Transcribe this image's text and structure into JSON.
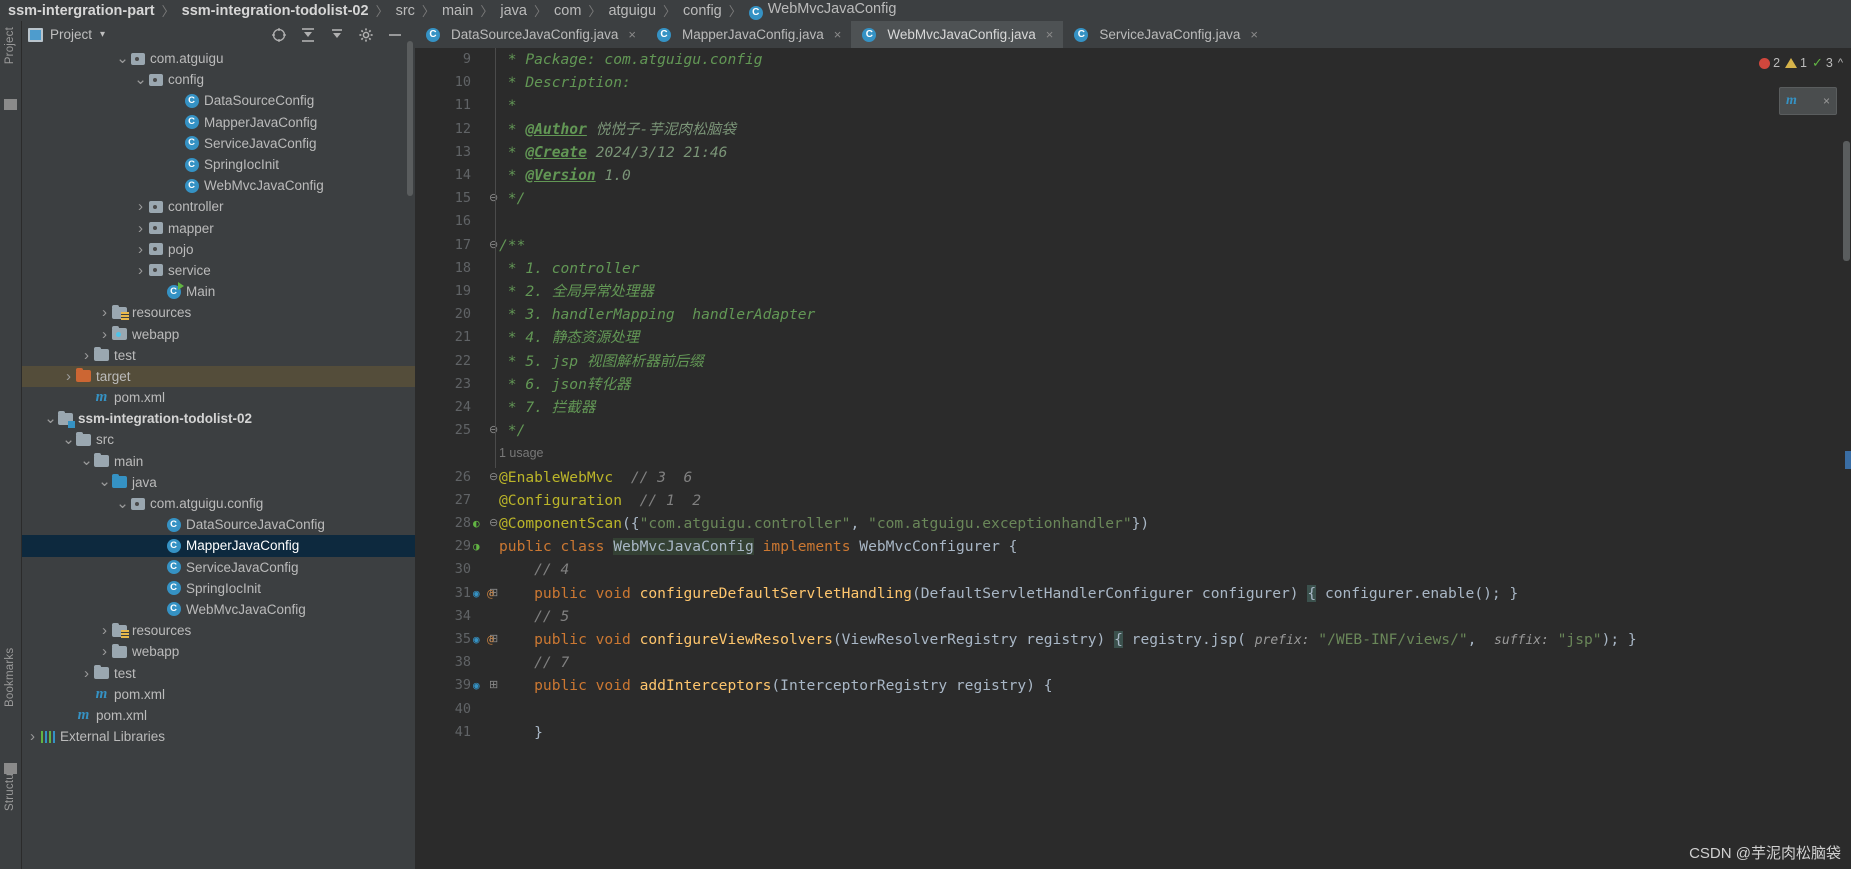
{
  "breadcrumb": {
    "items": [
      {
        "label": "ssm-intergration-part",
        "bold": true,
        "icon": null
      },
      {
        "label": "ssm-integration-todolist-02",
        "bold": true,
        "icon": null
      },
      {
        "label": "src",
        "bold": false,
        "icon": null
      },
      {
        "label": "main",
        "bold": false,
        "icon": null
      },
      {
        "label": "java",
        "bold": false,
        "icon": null
      },
      {
        "label": "com",
        "bold": false,
        "icon": null
      },
      {
        "label": "atguigu",
        "bold": false,
        "icon": null
      },
      {
        "label": "config",
        "bold": false,
        "icon": null
      },
      {
        "label": "WebMvcJavaConfig",
        "bold": false,
        "icon": "class-icon"
      }
    ],
    "separator": "〉"
  },
  "stripe": {
    "project_label": "Project",
    "bookmarks_label": "Bookmarks",
    "structure_label": "Structure"
  },
  "project_panel": {
    "title": "Project",
    "caret": "▾",
    "toolbar": [
      "locate-icon",
      "expand-all-icon",
      "collapse-all-icon",
      "settings-icon",
      "hide-icon"
    ],
    "tree": [
      {
        "indent": 5,
        "arrow": "v",
        "icon": "package-icon",
        "label": "com.atguigu",
        "state": "normal"
      },
      {
        "indent": 6,
        "arrow": "v",
        "icon": "package-icon",
        "label": "config",
        "state": "normal"
      },
      {
        "indent": 8,
        "arrow": "",
        "icon": "class-icon",
        "label": "DataSourceConfig",
        "state": "normal"
      },
      {
        "indent": 8,
        "arrow": "",
        "icon": "class-icon",
        "label": "MapperJavaConfig",
        "state": "normal"
      },
      {
        "indent": 8,
        "arrow": "",
        "icon": "class-icon",
        "label": "ServiceJavaConfig",
        "state": "normal"
      },
      {
        "indent": 8,
        "arrow": "",
        "icon": "class-icon",
        "label": "SpringIocInit",
        "state": "normal"
      },
      {
        "indent": 8,
        "arrow": "",
        "icon": "class-icon",
        "label": "WebMvcJavaConfig",
        "state": "normal"
      },
      {
        "indent": 6,
        "arrow": ">",
        "icon": "package-icon",
        "label": "controller",
        "state": "normal"
      },
      {
        "indent": 6,
        "arrow": ">",
        "icon": "package-icon",
        "label": "mapper",
        "state": "normal"
      },
      {
        "indent": 6,
        "arrow": ">",
        "icon": "package-icon",
        "label": "pojo",
        "state": "normal"
      },
      {
        "indent": 6,
        "arrow": ">",
        "icon": "package-icon",
        "label": "service",
        "state": "normal"
      },
      {
        "indent": 7,
        "arrow": "",
        "icon": "class-run-icon",
        "label": "Main",
        "state": "normal"
      },
      {
        "indent": 4,
        "arrow": ">",
        "icon": "resources-folder-icon",
        "label": "resources",
        "state": "normal"
      },
      {
        "indent": 4,
        "arrow": ">",
        "icon": "webapp-folder-icon",
        "label": "webapp",
        "state": "normal"
      },
      {
        "indent": 3,
        "arrow": ">",
        "icon": "folder-icon",
        "label": "test",
        "state": "normal"
      },
      {
        "indent": 2,
        "arrow": ">",
        "icon": "folder-orange-icon",
        "label": "target",
        "state": "highlight-target"
      },
      {
        "indent": 3,
        "arrow": "",
        "icon": "maven-icon",
        "label": "pom.xml",
        "state": "normal"
      },
      {
        "indent": 1,
        "arrow": "v",
        "icon": "module-folder-icon",
        "label": "ssm-integration-todolist-02",
        "state": "bold"
      },
      {
        "indent": 2,
        "arrow": "v",
        "icon": "folder-icon",
        "label": "src",
        "state": "normal"
      },
      {
        "indent": 3,
        "arrow": "v",
        "icon": "folder-icon",
        "label": "main",
        "state": "normal"
      },
      {
        "indent": 4,
        "arrow": "v",
        "icon": "source-folder-icon",
        "label": "java",
        "state": "normal"
      },
      {
        "indent": 5,
        "arrow": "v",
        "icon": "package-icon",
        "label": "com.atguigu.config",
        "state": "normal"
      },
      {
        "indent": 7,
        "arrow": "",
        "icon": "class-icon",
        "label": "DataSourceJavaConfig",
        "state": "normal"
      },
      {
        "indent": 7,
        "arrow": "",
        "icon": "class-icon",
        "label": "MapperJavaConfig",
        "state": "selected"
      },
      {
        "indent": 7,
        "arrow": "",
        "icon": "class-icon",
        "label": "ServiceJavaConfig",
        "state": "normal"
      },
      {
        "indent": 7,
        "arrow": "",
        "icon": "class-icon",
        "label": "SpringIocInit",
        "state": "normal"
      },
      {
        "indent": 7,
        "arrow": "",
        "icon": "class-icon",
        "label": "WebMvcJavaConfig",
        "state": "normal"
      },
      {
        "indent": 4,
        "arrow": ">",
        "icon": "resources-folder-icon",
        "label": "resources",
        "state": "normal"
      },
      {
        "indent": 4,
        "arrow": ">",
        "icon": "folder-icon",
        "label": "webapp",
        "state": "normal"
      },
      {
        "indent": 3,
        "arrow": ">",
        "icon": "folder-icon",
        "label": "test",
        "state": "normal"
      },
      {
        "indent": 3,
        "arrow": "",
        "icon": "maven-icon",
        "label": "pom.xml",
        "state": "normal"
      },
      {
        "indent": 2,
        "arrow": "",
        "icon": "maven-icon",
        "label": "pom.xml",
        "state": "normal"
      },
      {
        "indent": 0,
        "arrow": ">",
        "icon": "libraries-icon",
        "label": "External Libraries",
        "state": "normal"
      }
    ]
  },
  "editor": {
    "tabs": [
      {
        "label": "DataSourceJavaConfig.java",
        "active": false,
        "icon": "class-icon",
        "close": "×"
      },
      {
        "label": "MapperJavaConfig.java",
        "active": false,
        "icon": "class-icon",
        "close": "×"
      },
      {
        "label": "WebMvcJavaConfig.java",
        "active": true,
        "icon": "class-icon",
        "close": "×"
      },
      {
        "label": "ServiceJavaConfig.java",
        "active": false,
        "icon": "class-icon",
        "close": "×"
      }
    ],
    "inspection": {
      "error_count": "2",
      "warning_count": "1",
      "ok_count": "3",
      "error_color": "#d0473d",
      "warning_color": "#d6b34a",
      "ok_color": "#62b543"
    },
    "maven_popup": {
      "icon": "maven-icon",
      "close": "×"
    },
    "lines": [
      {
        "num": "9",
        "fold": "",
        "text": " * Package: com.atguigu.config",
        "style": "comment"
      },
      {
        "num": "10",
        "fold": "",
        "text": " * Description:",
        "style": "comment"
      },
      {
        "num": "11",
        "fold": "",
        "text": " *",
        "style": "comment"
      },
      {
        "num": "12",
        "fold": "",
        "text": " * @Author 悦悦子-芋泥肉松脑袋",
        "style": "comment-tag",
        "tag": "@Author",
        "rest": "悦悦子-芋泥肉松脑袋"
      },
      {
        "num": "13",
        "fold": "",
        "text": " * @Create 2024/3/12 21:46",
        "style": "comment-tag",
        "tag": "@Create",
        "rest": "2024/3/12 21:46"
      },
      {
        "num": "14",
        "fold": "",
        "text": " * @Version 1.0",
        "style": "comment-tag",
        "tag": "@Version",
        "rest": "1.0"
      },
      {
        "num": "15",
        "fold": "⊖",
        "text": " */",
        "style": "comment"
      },
      {
        "num": "16",
        "fold": "",
        "text": "",
        "style": "plain"
      },
      {
        "num": "17",
        "fold": "⊖",
        "text": "/**",
        "style": "comment"
      },
      {
        "num": "18",
        "fold": "",
        "text": " * 1. controller",
        "style": "comment"
      },
      {
        "num": "19",
        "fold": "",
        "text": " * 2. 全局异常处理器",
        "style": "comment"
      },
      {
        "num": "20",
        "fold": "",
        "text": " * 3. handlerMapping  handlerAdapter",
        "style": "comment"
      },
      {
        "num": "21",
        "fold": "",
        "text": " * 4. 静态资源处理",
        "style": "comment"
      },
      {
        "num": "22",
        "fold": "",
        "text": " * 5. jsp 视图解析器前后缀",
        "style": "comment"
      },
      {
        "num": "23",
        "fold": "",
        "text": " * 6. json转化器",
        "style": "comment"
      },
      {
        "num": "24",
        "fold": "",
        "text": " * 7. 拦截器",
        "style": "comment"
      },
      {
        "num": "25",
        "fold": "⊖",
        "text": " */",
        "style": "comment"
      }
    ],
    "usage_hint": "1 usage",
    "code": {
      "l26": {
        "num": "26",
        "anno": "@EnableWebMvc",
        "comment": "// 3  6"
      },
      "l27": {
        "num": "27",
        "anno": "@Configuration",
        "comment": "// 1  2"
      },
      "l28": {
        "num": "28",
        "anno": "@ComponentScan",
        "str1": "\"com.atguigu.controller\"",
        "str2": "\"com.atguigu.exceptionhandler\""
      },
      "l29": {
        "num": "29",
        "kw1": "public",
        "kw2": "class",
        "name": "WebMvcJavaConfig",
        "kw3": "implements",
        "iface": "WebMvcConfigurer"
      },
      "l30": {
        "num": "30",
        "comment": "// 4"
      },
      "l31": {
        "num": "31",
        "kw1": "public",
        "kw2": "void",
        "method": "configureDefaultServletHandling",
        "params": "DefaultServletHandlerConfigurer configurer",
        "body": "configurer.enable();"
      },
      "l34": {
        "num": "34",
        "comment": "// 5"
      },
      "l35": {
        "num": "35",
        "kw1": "public",
        "kw2": "void",
        "method": "configureViewResolvers",
        "params": "ViewResolverRegistry registry",
        "body": "registry.jsp(",
        "hint1": "prefix:",
        "str1": "\"/WEB-INF/views/\"",
        "hint2": "suffix:",
        "str2": "\"jsp\""
      },
      "l38": {
        "num": "38",
        "comment": "// 7"
      },
      "l39": {
        "num": "39",
        "kw1": "public",
        "kw2": "void",
        "method": "addInterceptors",
        "params": "InterceptorRegistry registry"
      },
      "l40": {
        "num": "40",
        "comment": ""
      },
      "l41": {
        "num": "41",
        "brace": "}"
      }
    }
  },
  "watermark": "CSDN @芋泥肉松脑袋"
}
